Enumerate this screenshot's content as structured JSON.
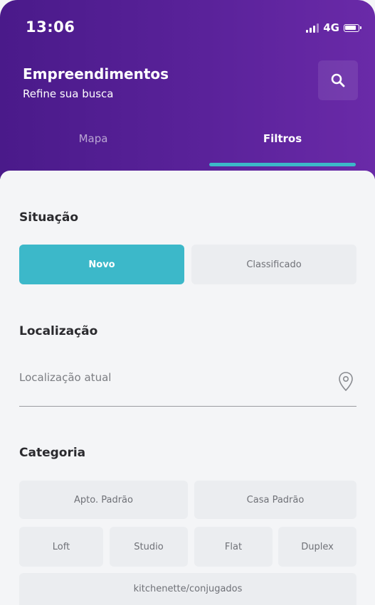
{
  "status_bar": {
    "time": "13:06",
    "network": "4G",
    "icons": [
      "signal-icon",
      "battery-icon"
    ]
  },
  "header": {
    "title": "Empreendimentos",
    "subtitle": "Refine sua busca",
    "search_icon": "search-icon"
  },
  "tabs": [
    {
      "label": "Mapa",
      "active": false
    },
    {
      "label": "Filtros",
      "active": true
    }
  ],
  "colors": {
    "header_gradient": [
      "#4a1a8a",
      "#6a2aa8"
    ],
    "accent": "#3cb8c9",
    "background": "#f4f5f7",
    "chip": "#ebedf0"
  },
  "situacao": {
    "title": "Situação",
    "options": [
      {
        "label": "Novo",
        "selected": true
      },
      {
        "label": "Classificado",
        "selected": false
      }
    ]
  },
  "localizacao": {
    "title": "Localização",
    "placeholder": "Localização atual",
    "icon": "location-pin-icon"
  },
  "categoria": {
    "title": "Categoria",
    "options": [
      {
        "label": "Apto. Padrão",
        "selected": false
      },
      {
        "label": "Casa Padrão",
        "selected": false
      },
      {
        "label": "Loft",
        "selected": false
      },
      {
        "label": "Studio",
        "selected": false
      },
      {
        "label": "Flat",
        "selected": false
      },
      {
        "label": "Duplex",
        "selected": false
      },
      {
        "label": "kitchenette/conjugados",
        "selected": false
      }
    ]
  }
}
